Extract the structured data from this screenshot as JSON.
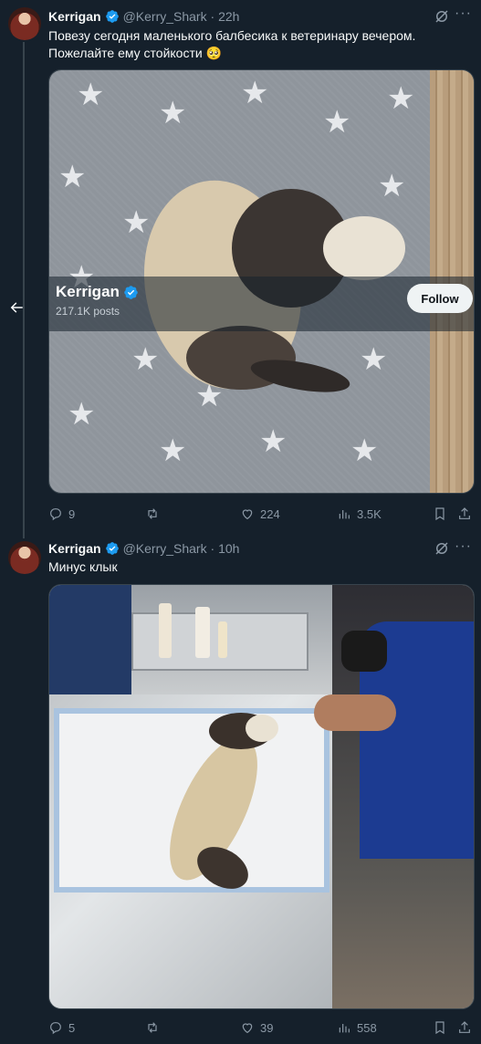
{
  "tweets": [
    {
      "name": "Kerrigan",
      "handle": "@Kerry_Shark",
      "time": "22h",
      "text": "Повезу сегодня маленького балбесика к ветеринару вечером. Пожелайте ему стойкости 🥺",
      "replies": "9",
      "likes": "224",
      "views": "3.5K"
    },
    {
      "name": "Kerrigan",
      "handle": "@Kerry_Shark",
      "time": "10h",
      "text": "Минус клык",
      "replies": "5",
      "likes": "39",
      "views": "558"
    }
  ],
  "hover_card": {
    "name": "Kerrigan",
    "posts": "217.1K posts",
    "follow_label": "Follow"
  },
  "separator": " · ",
  "colors": {
    "background": "#15202b",
    "verified": "#1d9bf0",
    "secondary_text": "#8b98a5"
  }
}
